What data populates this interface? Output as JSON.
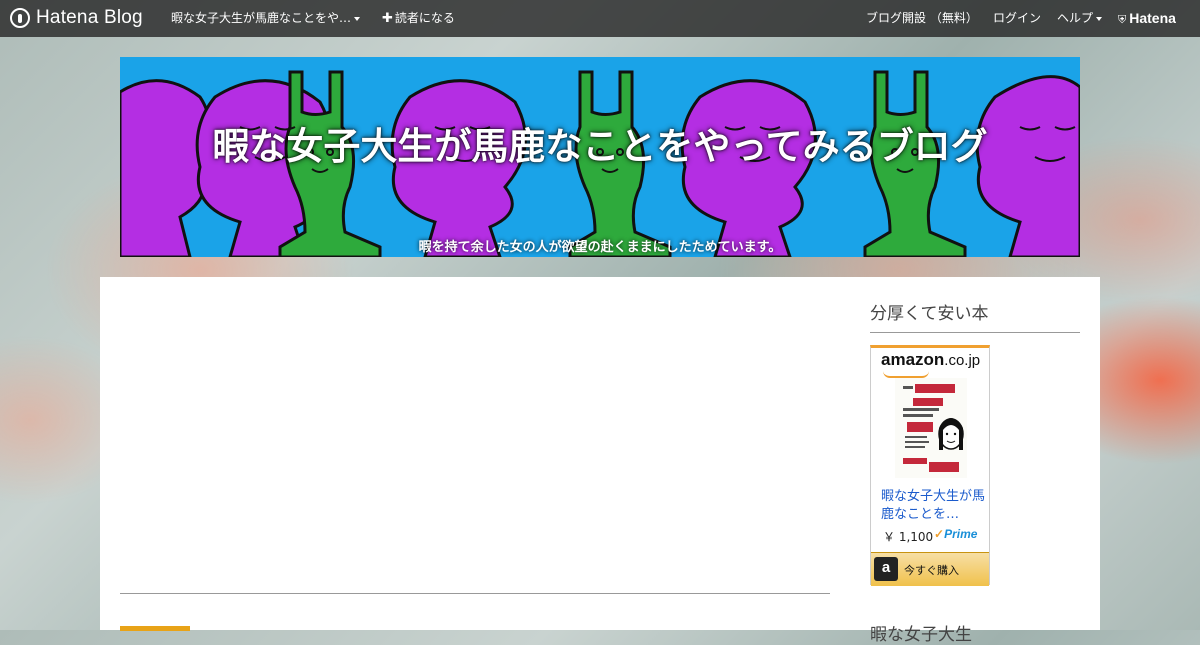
{
  "topbar": {
    "logo_text": "Hatena Blog",
    "blog_menu_label": "暇な女子大生が馬鹿なことをや…",
    "subscribe_label": "読者になる",
    "signup_label": "ブログ開設 （無料）",
    "login_label": "ログイン",
    "help_label": "ヘルプ",
    "brand_label": "Hatena"
  },
  "header": {
    "title": "暇な女子大生が馬鹿なことをやってみるブログ",
    "description": "暇を持て余した女の人が欲望の赴くままにしたためています。"
  },
  "sidebar": {
    "module_title": "分厚くて安い本",
    "next_module_title": "暇な女子大生",
    "amazon": {
      "logo_main": "amazon",
      "logo_tld": ".co.jp",
      "product_name": "暇な女子大生が馬鹿なことを…",
      "price": "￥ 1,100",
      "prime_label": "Prime",
      "buy_label": "今すぐ購入",
      "book_cover_text": "暇な女子大生が馬鹿なことを真剣に取り組む記録"
    }
  },
  "colors": {
    "topbar_bg": "#282828",
    "banner_bg": "#1aa3e8",
    "figure_purple": "#b42ee3",
    "figure_green": "#2eaa3c",
    "entry_tag": "#e8a317",
    "amazon_orange": "#f0a030",
    "link_blue": "#1b5bcc"
  }
}
